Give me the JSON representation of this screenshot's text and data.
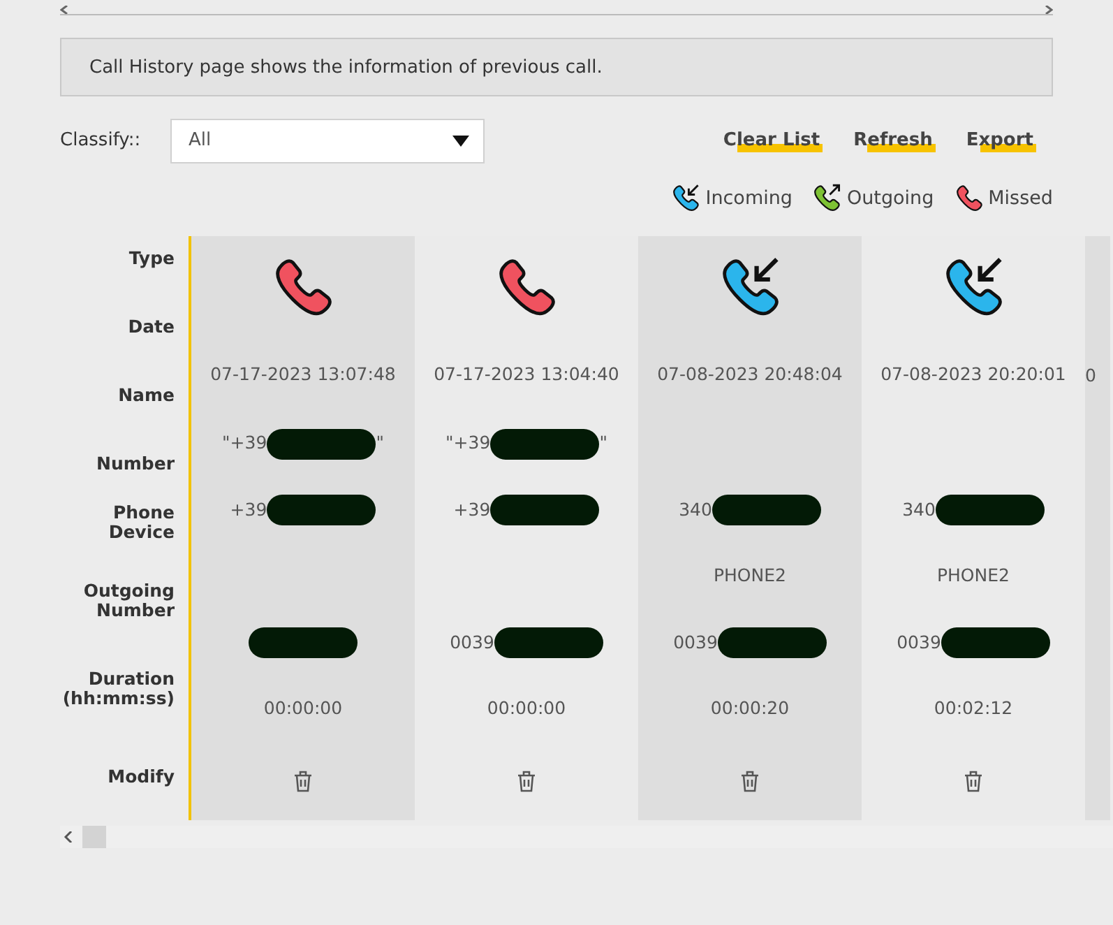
{
  "description": "Call History page shows the information of previous call.",
  "classify": {
    "label": "Classify::",
    "value": "All"
  },
  "actions": [
    "Clear List",
    "Refresh",
    "Export"
  ],
  "legend": [
    {
      "kind": "incoming",
      "label": "Incoming"
    },
    {
      "kind": "outgoing",
      "label": "Outgoing"
    },
    {
      "kind": "missed",
      "label": "Missed"
    }
  ],
  "row_labels": [
    "Type",
    "Date",
    "Name",
    "Number",
    "Phone Device",
    "Outgoing Number",
    "Duration (hh:mm:ss)",
    "Modify"
  ],
  "calls": [
    {
      "kind": "missed",
      "date": "07-17-2023 13:07:48",
      "name": {
        "prefix": "\"+39",
        "suffix": "\"",
        "redacted": true
      },
      "number": {
        "prefix": "+39",
        "redacted": true
      },
      "outgoing_number": {
        "redacted": true
      },
      "duration": "00:00:00"
    },
    {
      "kind": "missed",
      "date": "07-17-2023 13:04:40",
      "name": {
        "prefix": "\"+39",
        "suffix": "\"",
        "redacted": true
      },
      "number": {
        "prefix": "+39",
        "redacted": true
      },
      "outgoing_number": {
        "prefix": "0039",
        "redacted": true
      },
      "duration": "00:00:00"
    },
    {
      "kind": "incoming",
      "date": "07-08-2023 20:48:04",
      "number": {
        "prefix": "340",
        "redacted": true
      },
      "phone_device": "PHONE2",
      "outgoing_number": {
        "prefix": "0039",
        "redacted": true
      },
      "duration": "00:00:20"
    },
    {
      "kind": "incoming",
      "date": "07-08-2023 20:20:01",
      "number": {
        "prefix": "340",
        "redacted": true
      },
      "phone_device": "PHONE2",
      "outgoing_number": {
        "prefix": "0039",
        "redacted": true
      },
      "duration": "00:02:12"
    },
    {
      "kind": "partial",
      "date": "0"
    }
  ]
}
